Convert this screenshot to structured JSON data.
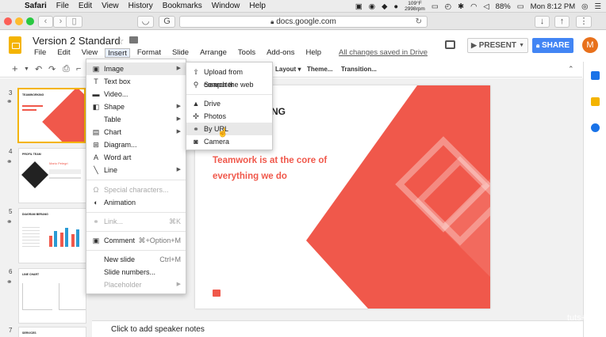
{
  "mac_menubar": {
    "app": "Safari",
    "items": [
      "File",
      "Edit",
      "View",
      "History",
      "Bookmarks",
      "Window",
      "Help"
    ],
    "weather": "109°F",
    "weather_sub": "2998rpm",
    "battery": "88%",
    "clock": "Mon 8:12 PM"
  },
  "browser": {
    "url": "docs.google.com"
  },
  "docs": {
    "title": "Version 2 Standard",
    "menus": [
      "File",
      "Edit",
      "View",
      "Insert",
      "Format",
      "Slide",
      "Arrange",
      "Tools",
      "Add-ons",
      "Help"
    ],
    "saved_status": "All changes saved in Drive",
    "present_label": "PRESENT",
    "share_label": "SHARE",
    "avatar_letter": "M",
    "toolbar_labels": [
      "Layout",
      "Theme...",
      "Transition..."
    ]
  },
  "insert_menu": {
    "items": [
      {
        "label": "Image",
        "icon": "image-icon",
        "submenu": true
      },
      {
        "label": "Text box",
        "icon": "textbox-icon"
      },
      {
        "label": "Video...",
        "icon": "video-icon"
      },
      {
        "label": "Shape",
        "icon": "shape-icon",
        "submenu": true
      },
      {
        "label": "Table",
        "icon": "",
        "submenu": true
      },
      {
        "label": "Chart",
        "icon": "chart-icon",
        "submenu": true
      },
      {
        "label": "Diagram...",
        "icon": "diagram-icon"
      },
      {
        "label": "Word art",
        "icon": "wordart-icon"
      },
      {
        "label": "Line",
        "icon": "line-icon",
        "submenu": true
      },
      {
        "label": "Special characters...",
        "icon": "omega-icon",
        "disabled": true
      },
      {
        "label": "Animation",
        "icon": "animation-icon"
      },
      {
        "label": "Link...",
        "icon": "link-icon",
        "disabled": true,
        "shortcut": "⌘K"
      },
      {
        "label": "Comment",
        "icon": "comment-icon",
        "shortcut": "⌘+Option+M"
      },
      {
        "label": "New slide",
        "icon": "",
        "shortcut": "Ctrl+M"
      },
      {
        "label": "Slide numbers...",
        "icon": ""
      },
      {
        "label": "Placeholder",
        "icon": "",
        "disabled": true,
        "submenu": true
      }
    ]
  },
  "image_submenu": {
    "items": [
      {
        "label": "Upload from computer",
        "icon": "upload-icon"
      },
      {
        "label": "Search the web",
        "icon": "search-icon"
      },
      {
        "label": "Drive",
        "icon": "drive-icon"
      },
      {
        "label": "Photos",
        "icon": "photos-icon"
      },
      {
        "label": "By URL",
        "icon": "link-icon"
      },
      {
        "label": "Camera",
        "icon": "camera-icon"
      }
    ]
  },
  "filmstrip": {
    "slides": [
      {
        "num": "3",
        "title": "TEAMWORKING"
      },
      {
        "num": "4",
        "title": "PROFIL TEAM",
        "name": "Mario Pelegri"
      },
      {
        "num": "5",
        "title": "DIAGRAM BERANG"
      },
      {
        "num": "6",
        "title": "LINE CHART"
      },
      {
        "num": "7",
        "title": "SERVICES"
      }
    ]
  },
  "slide": {
    "heading_fragment": "NG",
    "quote_mark": "“",
    "quote_line1": "Teamwork is at the core of",
    "quote_line2": "everything we do"
  },
  "notes_placeholder": "Click to add speaker notes",
  "watermark": "tuts+",
  "colors": {
    "accent_red": "#f0584b",
    "share_blue": "#4285f4",
    "slides_yellow": "#f4b400",
    "avatar_orange": "#e8711c"
  }
}
